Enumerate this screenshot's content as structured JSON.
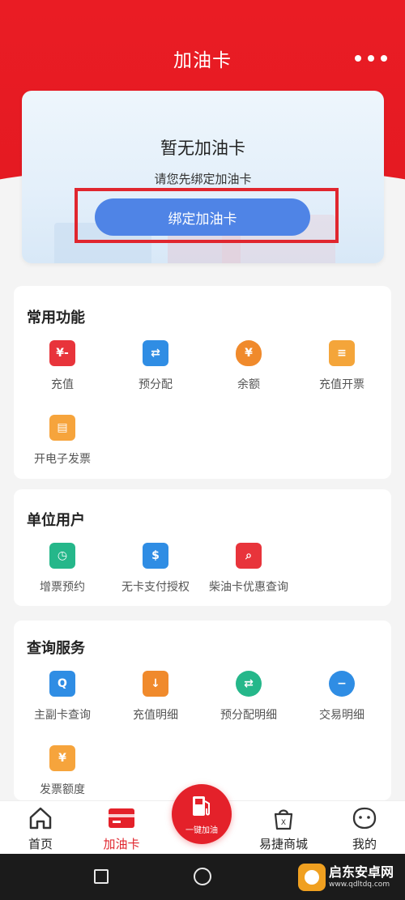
{
  "header": {
    "title": "加油卡",
    "more_icon": "more-dots-icon"
  },
  "empty_card": {
    "title": "暂无加油卡",
    "subtitle": "请您先绑定加油卡",
    "bind_button": "绑定加油卡"
  },
  "sections": {
    "common": {
      "title": "常用功能",
      "items": [
        {
          "label": "充值",
          "icon": "recharge-icon",
          "color": "#e8343b",
          "glyph": "¥"
        },
        {
          "label": "预分配",
          "icon": "transfer-icon",
          "color": "#2f8de4",
          "glyph": "⇄"
        },
        {
          "label": "余额",
          "icon": "money-bag-icon",
          "color": "#f08a2c",
          "glyph": "¥"
        },
        {
          "label": "充值开票",
          "icon": "invoice-icon",
          "color": "#f4a53a",
          "glyph": "≡"
        },
        {
          "label": "开电子发票",
          "icon": "e-invoice-icon",
          "color": "#f6a43c",
          "glyph": "▤"
        }
      ]
    },
    "unit": {
      "title": "单位用户",
      "items": [
        {
          "label": "增票预约",
          "icon": "ticket-clock-icon",
          "color": "#25b78a",
          "glyph": "◷"
        },
        {
          "label": "无卡支付授权",
          "icon": "cardless-pay-icon",
          "color": "#2f8de4",
          "glyph": "$"
        },
        {
          "label": "柴油卡优惠查询",
          "icon": "diesel-search-icon",
          "color": "#e8343b",
          "glyph": "⌕"
        }
      ]
    },
    "query": {
      "title": "查询服务",
      "items": [
        {
          "label": "主副卡查询",
          "icon": "card-search-icon",
          "color": "#2f8de4",
          "glyph": "Q"
        },
        {
          "label": "充值明细",
          "icon": "recharge-detail-icon",
          "color": "#f08a2c",
          "glyph": "↓"
        },
        {
          "label": "预分配明细",
          "icon": "allocation-detail-icon",
          "color": "#25b78a",
          "glyph": "⇄"
        },
        {
          "label": "交易明细",
          "icon": "transaction-detail-icon",
          "color": "#2f8de4",
          "glyph": "−"
        },
        {
          "label": "发票额度",
          "icon": "invoice-quota-icon",
          "color": "#f6a43c",
          "glyph": "¥"
        }
      ]
    }
  },
  "tabbar": {
    "items": [
      {
        "label": "首页",
        "icon": "home-icon"
      },
      {
        "label": "加油卡",
        "icon": "fuel-card-icon"
      },
      {
        "label": "易捷商城",
        "icon": "shopping-bag-icon"
      },
      {
        "label": "我的",
        "icon": "profile-icon"
      }
    ],
    "center": {
      "label": "一键加油",
      "icon": "fuel-pump-icon"
    }
  },
  "watermark": {
    "name": "启东安卓网",
    "url": "www.qdltdq.com"
  },
  "colors": {
    "brand_red": "#e41a22",
    "button_blue": "#4f84e6"
  }
}
